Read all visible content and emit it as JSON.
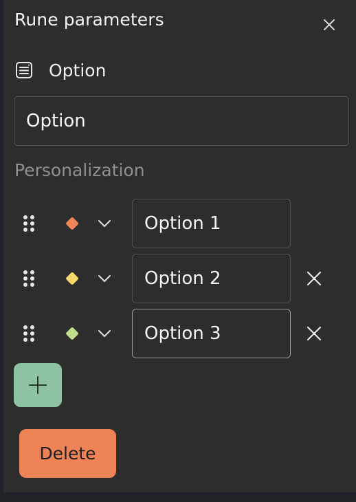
{
  "panel": {
    "title": "Rune parameters",
    "close_icon": "close-icon"
  },
  "rune_type": {
    "icon": "option-list-icon",
    "label": "Option"
  },
  "name_field": {
    "value": "Option"
  },
  "personalization": {
    "label": "Personalization",
    "options": [
      {
        "label": "Option 1",
        "color": "#f08559",
        "removable": false,
        "focused": false
      },
      {
        "label": "Option 2",
        "color": "#f7d86a",
        "removable": true,
        "focused": false
      },
      {
        "label": "Option 3",
        "color": "#bfdf8c",
        "removable": true,
        "focused": true
      }
    ]
  },
  "add_button": {
    "icon": "plus-icon",
    "color": "#8dc2a2"
  },
  "delete_button": {
    "label": "Delete",
    "color": "#ee8356"
  }
}
